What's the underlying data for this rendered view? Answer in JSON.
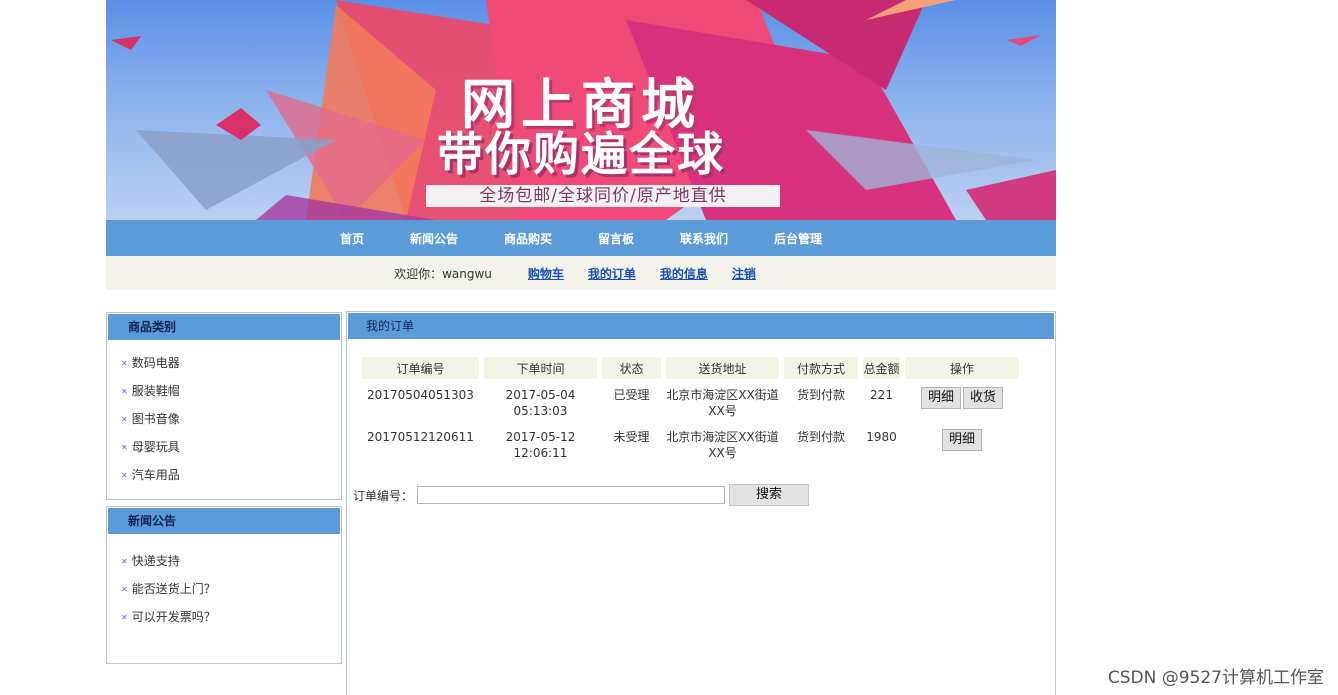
{
  "banner": {
    "title": "网上商城",
    "subtitle": "带你购遍全球",
    "tagline": "全场包邮/全球同价/原产地直供"
  },
  "nav": [
    "首页",
    "新闻公告",
    "商品购买",
    "留言板",
    "联系我们",
    "后台管理"
  ],
  "welcome": {
    "greeting": "欢迎你：wangwu",
    "links": [
      "购物车",
      "我的订单",
      "我的信息",
      "注销"
    ]
  },
  "categories": {
    "title": "商品类别",
    "items": [
      "数码电器",
      "服装鞋帽",
      "图书音像",
      "母婴玩具",
      "汽车用品"
    ]
  },
  "news": {
    "title": "新闻公告",
    "items": [
      "快递支持",
      "能否送货上门？",
      "可以开发票吗？"
    ]
  },
  "orders": {
    "title": "我的订单",
    "columns": [
      "订单编号",
      "下单时间",
      "状态",
      "送货地址",
      "付款方式",
      "总金额",
      "操作"
    ],
    "rows": [
      {
        "id": "20170504051303",
        "date": "2017-05-04",
        "time": "05:13:03",
        "status": "已受理",
        "addr1": "北京市海淀区XX街道",
        "addr2": "XX号",
        "payment": "货到付款",
        "total": "221",
        "actions": [
          "明细",
          "收货"
        ]
      },
      {
        "id": "20170512120611",
        "date": "2017-05-12",
        "time": "12:06:11",
        "status": "未受理",
        "addr1": "北京市海淀区XX街道",
        "addr2": "XX号",
        "payment": "货到付款",
        "total": "1980",
        "actions": [
          "明细"
        ]
      }
    ],
    "search_label": "订单编号：",
    "search_value": "",
    "search_button": "搜索"
  },
  "watermark": "CSDN @9527计算机工作室"
}
